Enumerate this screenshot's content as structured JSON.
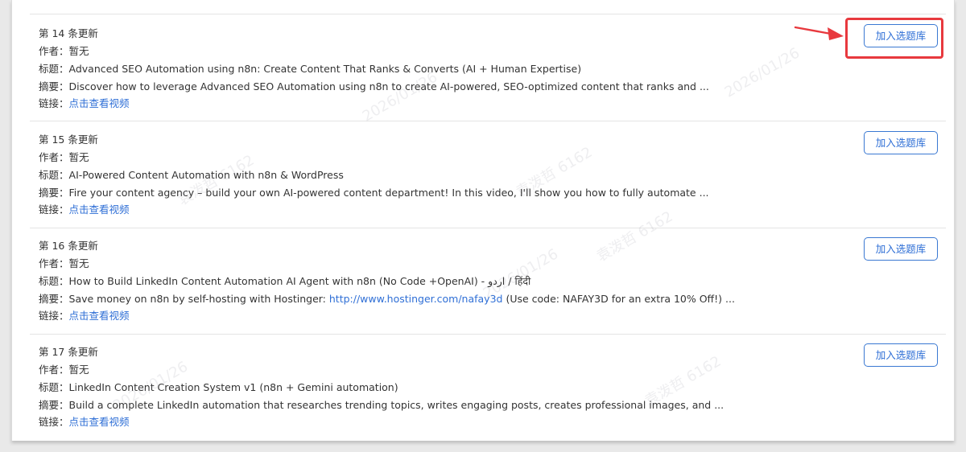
{
  "labels": {
    "author": "作者：",
    "title": "标题：",
    "summary": "摘要：",
    "link": "链接："
  },
  "add_button_label": "加入选题库",
  "items": [
    {
      "header": "第 14 条更新",
      "author": "暂无",
      "title": "Advanced SEO Automation using n8n: Create Content That Ranks & Converts (AI  + Human Expertise)",
      "summary_before": "Discover how to leverage Advanced SEO Automation using n8n to create AI-powered, SEO-optimized content that ranks and ...",
      "summary_link": "",
      "summary_after": "",
      "link_text": "点击查看视频"
    },
    {
      "header": "第 15 条更新",
      "author": "暂无",
      "title": "AI-Powered Content Automation with n8n & WordPress",
      "summary_before": "Fire your content agency – build your own AI-powered content department! In this video, I'll show you how to fully automate ...",
      "summary_link": "",
      "summary_after": "",
      "link_text": "点击查看视频"
    },
    {
      "header": "第 16 条更新",
      "author": "暂无",
      "title": "How to Build LinkedIn Content Automation AI Agent with n8n (No Code +OpenAI)  -  اردو / हिंदी",
      "summary_before": "Save money on n8n by self-hosting with Hostinger: ",
      "summary_link": "http://www.hostinger.com/nafay3d",
      "summary_after": " (Use code: NAFAY3D for an extra 10% Off!) ...",
      "link_text": "点击查看视频"
    },
    {
      "header": "第 17 条更新",
      "author": "暂无",
      "title": "LinkedIn Content Creation System v1 (n8n + Gemini automation)",
      "summary_before": "Build a complete LinkedIn automation that researches trending topics, writes engaging posts, creates professional images, and ...",
      "summary_link": "",
      "summary_after": "",
      "link_text": "点击查看视频"
    }
  ],
  "watermark": [
    "袁泼哲 6162",
    "2026/01/26"
  ],
  "colors": {
    "link": "#2f6fd6",
    "button_border": "#3a78d2",
    "highlight": "#e8393e",
    "text": "#333333"
  }
}
